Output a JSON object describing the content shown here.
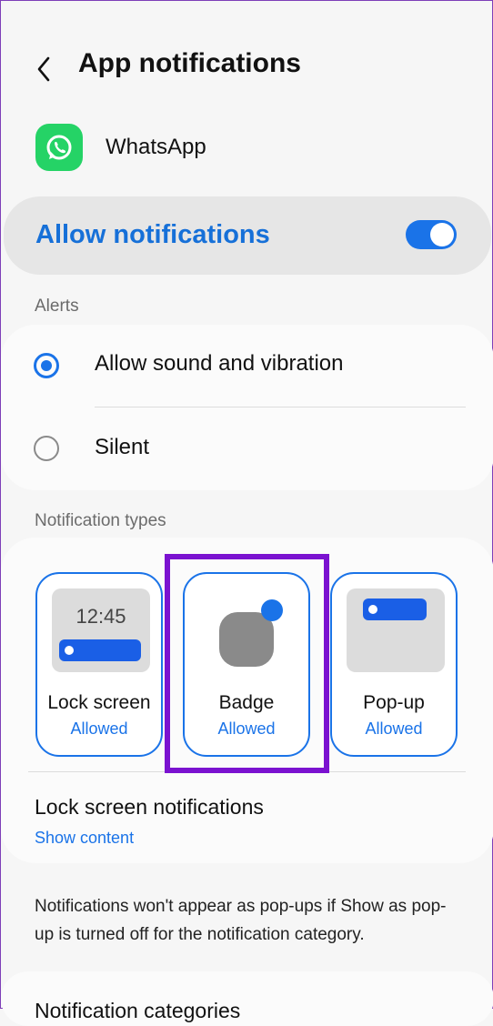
{
  "header": {
    "title": "App notifications"
  },
  "app": {
    "name": "WhatsApp",
    "icon": "whatsapp-icon",
    "icon_color": "#25d366"
  },
  "allow": {
    "label": "Allow notifications",
    "enabled": true,
    "accent": "#1a73e8"
  },
  "alerts": {
    "section_label": "Alerts",
    "options": [
      {
        "label": "Allow sound and vibration",
        "selected": true
      },
      {
        "label": "Silent",
        "selected": false
      }
    ]
  },
  "types": {
    "section_label": "Notification types",
    "tiles": [
      {
        "name": "Lock screen",
        "status": "Allowed",
        "preview_time": "12:45"
      },
      {
        "name": "Badge",
        "status": "Allowed"
      },
      {
        "name": "Pop-up",
        "status": "Allowed"
      }
    ],
    "highlight_color": "#7b12d0"
  },
  "lock_screen": {
    "title": "Lock screen notifications",
    "value": "Show content"
  },
  "note": "Notifications won't appear as pop-ups if Show as pop-up is turned off for the notification category.",
  "categories": {
    "label": "Notification categories"
  }
}
